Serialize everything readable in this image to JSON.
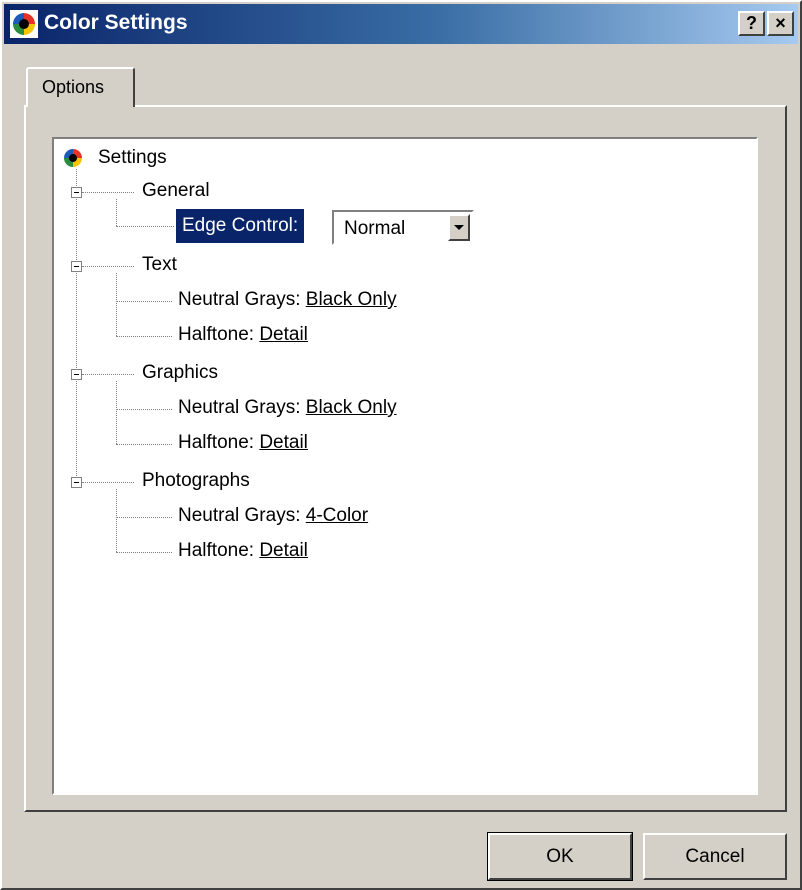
{
  "window": {
    "title": "Color Settings",
    "help_label": "?",
    "close_label": "×"
  },
  "tabs": [
    {
      "label": "Options"
    }
  ],
  "tree": {
    "root": {
      "label": "Settings"
    },
    "general": {
      "label": "General",
      "edge_control_label": "Edge Control:",
      "edge_control_value": "Normal"
    },
    "text": {
      "label": "Text",
      "neutral_grays_label": "Neutral Grays:",
      "neutral_grays_value": "Black Only",
      "halftone_label": "Halftone:",
      "halftone_value": "Detail"
    },
    "graphics": {
      "label": "Graphics",
      "neutral_grays_label": "Neutral Grays:",
      "neutral_grays_value": "Black Only",
      "halftone_label": "Halftone:",
      "halftone_value": "Detail"
    },
    "photographs": {
      "label": "Photographs",
      "neutral_grays_label": "Neutral Grays:",
      "neutral_grays_value": "4-Color",
      "halftone_label": "Halftone:",
      "halftone_value": "Detail"
    }
  },
  "buttons": {
    "ok": "OK",
    "cancel": "Cancel"
  },
  "colors": {
    "titlebar_start": "#0a246a",
    "titlebar_end": "#a6caf0",
    "selection": "#0a246a",
    "face": "#d4d0c8"
  }
}
